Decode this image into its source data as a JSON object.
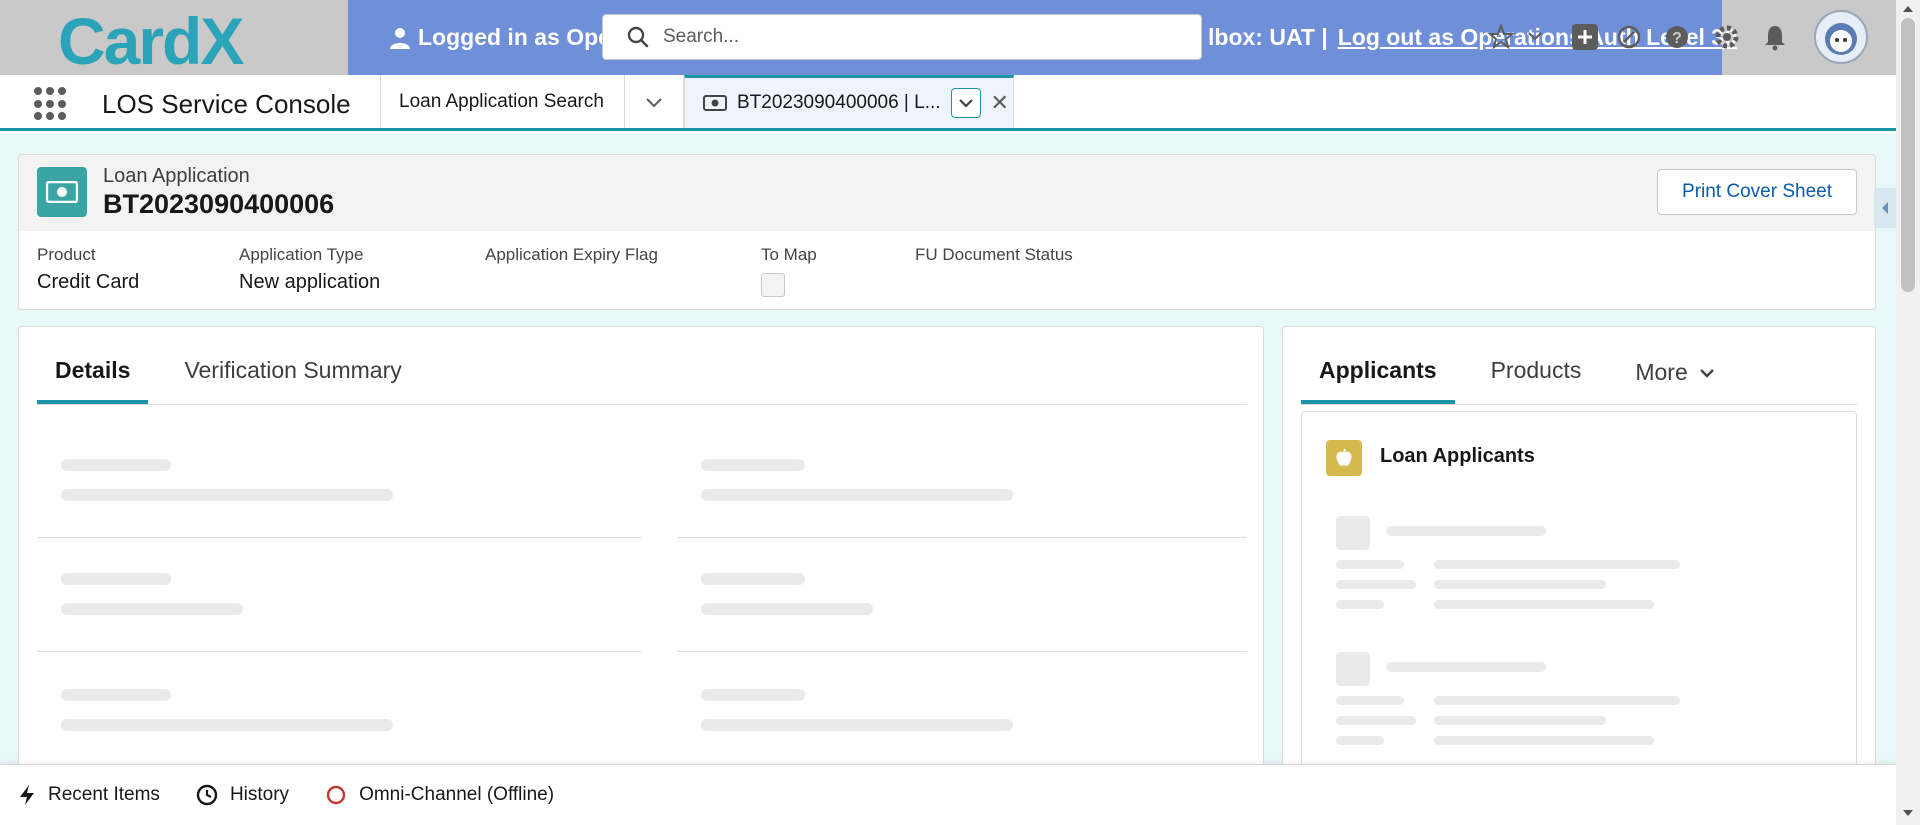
{
  "header": {
    "logo_text": "CardX",
    "impersonation_left": "Logged in as Ope",
    "impersonation_sandbox": "lbox: UAT |",
    "logout_text": "Log out as Operations Auth Level 30",
    "search_placeholder": "Search...",
    "brand_color": "#1b96a8"
  },
  "nav": {
    "app_name": "LOS Service Console",
    "tabs": [
      {
        "label": "Loan Application Search"
      },
      {
        "label": "BT2023090400006 | L..."
      }
    ]
  },
  "record": {
    "object_label": "Loan Application",
    "name": "BT2023090400006",
    "print_button": "Print Cover Sheet",
    "fields": [
      {
        "label": "Product",
        "value": "Credit Card"
      },
      {
        "label": "Application Type",
        "value": "New application"
      },
      {
        "label": "Application Expiry Flag",
        "value": ""
      },
      {
        "label": "To Map",
        "value": ""
      },
      {
        "label": "FU Document Status",
        "value": ""
      }
    ],
    "to_map_checked": false
  },
  "details_tabs": [
    {
      "label": "Details",
      "active": true
    },
    {
      "label": "Verification Summary",
      "active": false
    }
  ],
  "related_tabs": [
    {
      "label": "Applicants",
      "active": true
    },
    {
      "label": "Products",
      "active": false
    },
    {
      "label": "More",
      "active": false
    }
  ],
  "related": {
    "loan_applicants_title": "Loan Applicants"
  },
  "utility_bar": {
    "items": [
      {
        "label": "Recent Items",
        "icon": "lightning-icon"
      },
      {
        "label": "History",
        "icon": "clock-icon"
      },
      {
        "label": "Omni-Channel (Offline)",
        "icon": "offline-status-icon"
      }
    ]
  }
}
